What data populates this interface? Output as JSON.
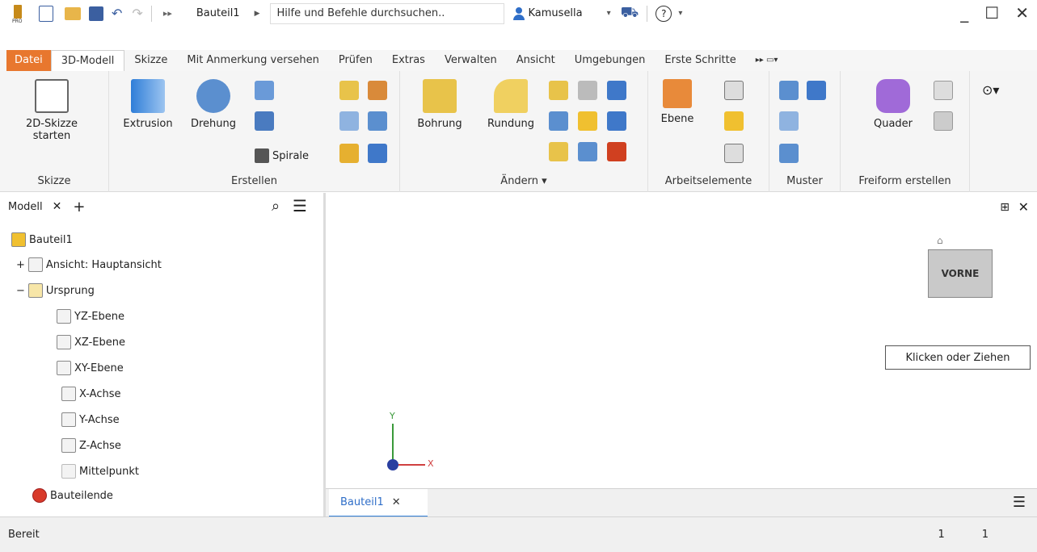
{
  "title_bar": {
    "document": "Bauteil1",
    "search_placeholder": "Hilfe und Befehle durchsuchen..",
    "user": "Kamusella",
    "app_badge": "PRO",
    "help": "?"
  },
  "tabs": [
    "Datei",
    "3D-Modell",
    "Skizze",
    "Mit Anmerkung versehen",
    "Prüfen",
    "Extras",
    "Verwalten",
    "Ansicht",
    "Umgebungen",
    "Erste Schritte"
  ],
  "ribbon": {
    "skizze": {
      "btn_line1": "2D-Skizze",
      "btn_line2": "starten",
      "group": "Skizze"
    },
    "erstellen": {
      "extrusion": "Extrusion",
      "drehung": "Drehung",
      "spirale": "Spirale",
      "group": "Erstellen"
    },
    "aendern": {
      "bohrung": "Bohrung",
      "rundung": "Rundung",
      "group": "Ändern ▾"
    },
    "arbeitselemente": {
      "ebene": "Ebene",
      "group": "Arbeitselemente"
    },
    "muster": {
      "group": "Muster"
    },
    "freiform": {
      "quader": "Quader",
      "group": "Freiform erstellen"
    }
  },
  "browser": {
    "tab": "Modell",
    "items": [
      "Bauteil1",
      "Ansicht: Hauptansicht",
      "Ursprung",
      "YZ-Ebene",
      "XZ-Ebene",
      "XY-Ebene",
      "X-Achse",
      "Y-Achse",
      "Z-Achse",
      "Mittelpunkt",
      "Bauteilende"
    ]
  },
  "viewport": {
    "viewcube": "VORNE",
    "tooltip": "Klicken oder Ziehen",
    "axis_x": "X",
    "axis_y": "Y"
  },
  "doc_tab": "Bauteil1",
  "status": {
    "text": "Bereit",
    "v1": "1",
    "v2": "1"
  }
}
